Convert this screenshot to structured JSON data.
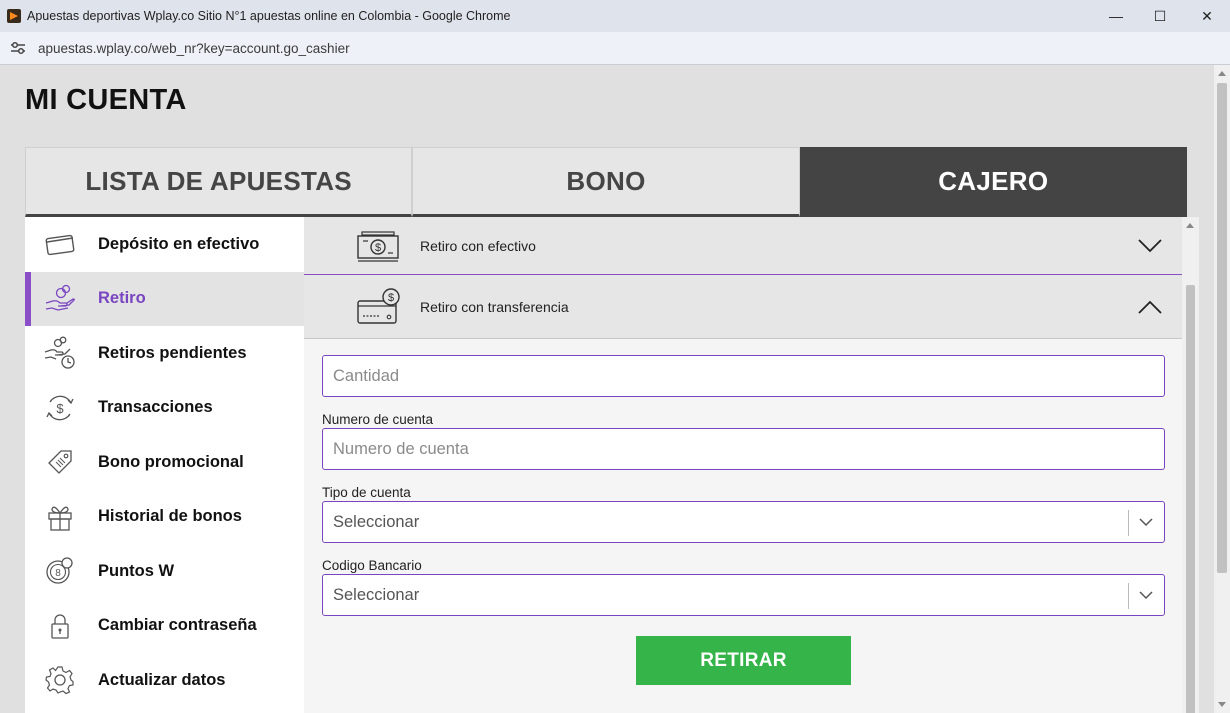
{
  "window": {
    "title": "Apuestas deportivas Wplay.co Sitio N°1 apuestas online en Colombia - Google Chrome",
    "url": "apuestas.wplay.co/web_nr?key=account.go_cashier",
    "minimize": "—",
    "maximize": "☐",
    "close": "✕"
  },
  "page": {
    "title": "MI CUENTA"
  },
  "tabs": [
    {
      "label": "LISTA DE APUESTAS",
      "active": false
    },
    {
      "label": "BONO",
      "active": false
    },
    {
      "label": "CAJERO",
      "active": true
    }
  ],
  "sidebar": {
    "items": [
      {
        "label": "Depósito en efectivo",
        "icon": "card-icon",
        "active": false
      },
      {
        "label": "Retiro",
        "icon": "hand-money-icon",
        "active": true
      },
      {
        "label": "Retiros pendientes",
        "icon": "pending-withdrawal-icon",
        "active": false
      },
      {
        "label": "Transacciones",
        "icon": "dollar-refresh-icon",
        "active": false
      },
      {
        "label": "Bono promocional",
        "icon": "tag-icon",
        "active": false
      },
      {
        "label": "Historial de bonos",
        "icon": "gift-icon",
        "active": false
      },
      {
        "label": "Puntos W",
        "icon": "coins-icon",
        "active": false
      },
      {
        "label": "Cambiar contraseña",
        "icon": "lock-icon",
        "active": false
      },
      {
        "label": "Actualizar datos",
        "icon": "gear-icon",
        "active": false
      }
    ]
  },
  "accordion": {
    "cash_label": "Retiro con efectivo",
    "transfer_label": "Retiro con transferencia"
  },
  "form": {
    "amount_placeholder": "Cantidad",
    "account_number_label": "Numero de cuenta",
    "account_number_placeholder": "Numero de cuenta",
    "account_type_label": "Tipo de cuenta",
    "account_type_value": "Seleccionar",
    "bank_code_label": "Codigo Bancario",
    "bank_code_value": "Seleccionar",
    "submit_label": "RETIRAR"
  },
  "colors": {
    "accent": "#8a4fc7",
    "tab_active": "#444444",
    "submit": "#35b44a"
  }
}
